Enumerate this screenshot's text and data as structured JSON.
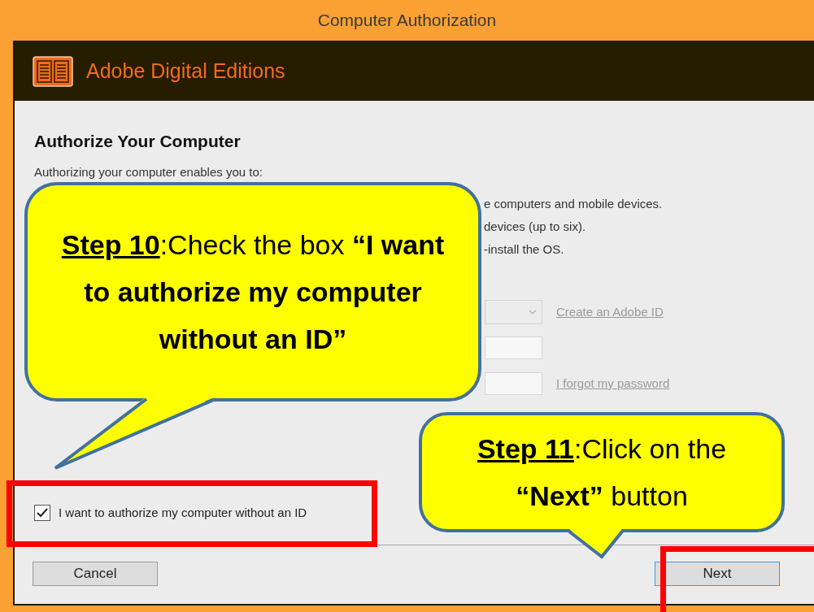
{
  "window": {
    "title": "Computer Authorization"
  },
  "header": {
    "app_name": "Adobe Digital Editions"
  },
  "heading": "Authorize Your Computer",
  "intro": "Authorizing your computer enables you to:",
  "benefits": [
    "e computers and mobile devices.",
    "devices (up to six).",
    "-install the OS."
  ],
  "form": {
    "rows": [
      {
        "kind": "dropdown",
        "link": "Create an Adobe ID"
      },
      {
        "kind": "field"
      },
      {
        "kind": "field",
        "link": "I forgot my password"
      }
    ]
  },
  "checkbox": {
    "label": "I want to authorize my computer without an ID",
    "checked": true
  },
  "buttons": [
    {
      "label": "Cancel",
      "default": false
    },
    {
      "label": "Next",
      "default": true
    }
  ],
  "callouts": [
    {
      "segments": [
        {
          "kind": "step",
          "text": "Step 10"
        },
        {
          "kind": "plain",
          "text": ":Check the box  "
        },
        {
          "kind": "bold",
          "text": "“I want to authorize my computer without an ID”"
        }
      ]
    },
    {
      "segments": [
        {
          "kind": "step",
          "text": "Step 11"
        },
        {
          "kind": "plain",
          "text": ":Click on the "
        },
        {
          "kind": "bold",
          "text": "“Next”"
        },
        {
          "kind": "plain",
          "text": " button"
        }
      ]
    }
  ]
}
